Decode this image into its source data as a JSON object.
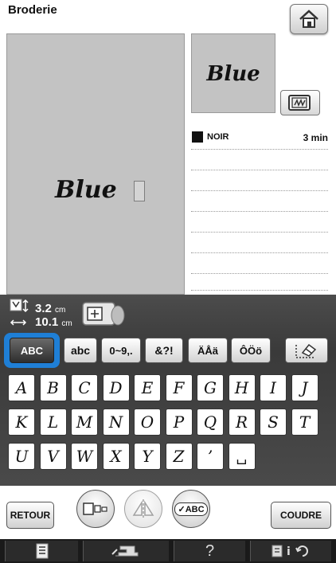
{
  "header": {
    "title": "Broderie",
    "home_icon": "home-icon"
  },
  "preview": {
    "main_text": "Blue",
    "thumbnail_text": "Blue"
  },
  "thread": {
    "color_name": "NOIR",
    "time": "3 min",
    "swatch_color": "#111111"
  },
  "size": {
    "height_value": "3.2",
    "height_unit": "cm",
    "width_value": "10.1",
    "width_unit": "cm"
  },
  "tabs": {
    "uppercase": "ABC",
    "lowercase": "abc",
    "digits": "0~9,.",
    "symbols": "&?!",
    "accents_upper": "ÄÅä",
    "accents_lower": "ÔÖö",
    "edit_icon": "eraser-icon"
  },
  "keyboard": {
    "rows": [
      [
        "A",
        "B",
        "C",
        "D",
        "E",
        "F",
        "G",
        "H",
        "I",
        "J"
      ],
      [
        "K",
        "L",
        "M",
        "N",
        "O",
        "P",
        "Q",
        "R",
        "S",
        "T"
      ],
      [
        "U",
        "V",
        "W",
        "X",
        "Y",
        "Z",
        "’",
        "␣"
      ]
    ]
  },
  "bottom_buttons": {
    "back": "RETOUR",
    "sew": "COUDRE",
    "abc_edit": "ABC"
  },
  "bottom_bar": {
    "help": "?"
  },
  "colors": {
    "accent": "#1f7fd6",
    "toolbar": "#444444",
    "preview_bg": "#c3c3c3"
  }
}
